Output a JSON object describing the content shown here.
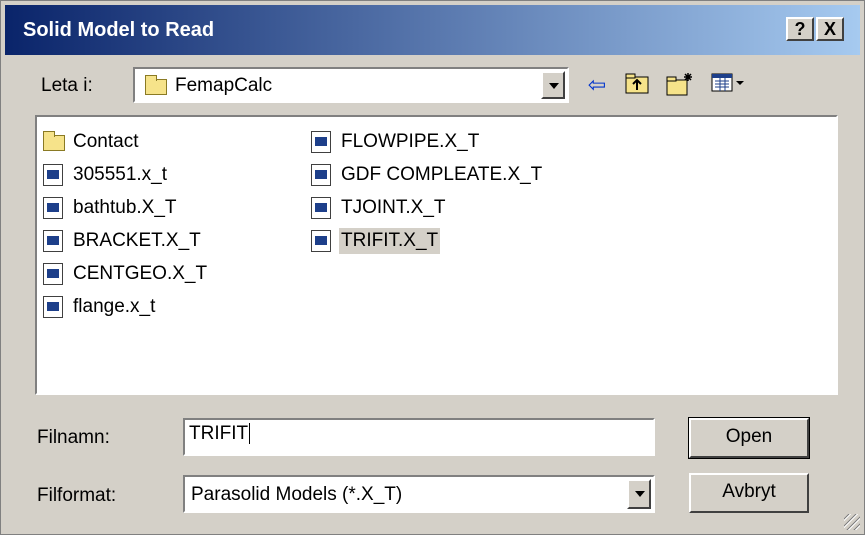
{
  "window": {
    "title": "Solid Model to Read",
    "help_label": "?",
    "close_label": "X"
  },
  "toolbar": {
    "look_in_label": "Leta i:",
    "look_in_value": "FemapCalc",
    "back_icon": "back-arrow-icon",
    "up_icon": "up-folder-icon",
    "new_folder_icon": "new-folder-icon",
    "view_icon": "view-menu-icon"
  },
  "files": [
    {
      "name": "Contact",
      "type": "folder"
    },
    {
      "name": "305551.x_t",
      "type": "file"
    },
    {
      "name": "bathtub.X_T",
      "type": "file"
    },
    {
      "name": "BRACKET.X_T",
      "type": "file"
    },
    {
      "name": "CENTGEO.X_T",
      "type": "file"
    },
    {
      "name": "flange.x_t",
      "type": "file"
    },
    {
      "name": "FLOWPIPE.X_T",
      "type": "file"
    },
    {
      "name": "GDF COMPLEATE.X_T",
      "type": "file"
    },
    {
      "name": "TJOINT.X_T",
      "type": "file"
    },
    {
      "name": "TRIFIT.X_T",
      "type": "file",
      "selected": true
    }
  ],
  "filename": {
    "label": "Filnamn:",
    "value": "TRIFIT"
  },
  "fileformat": {
    "label": "Filformat:",
    "value": "Parasolid Models (*.X_T)"
  },
  "buttons": {
    "open": "Open",
    "cancel": "Avbryt"
  }
}
